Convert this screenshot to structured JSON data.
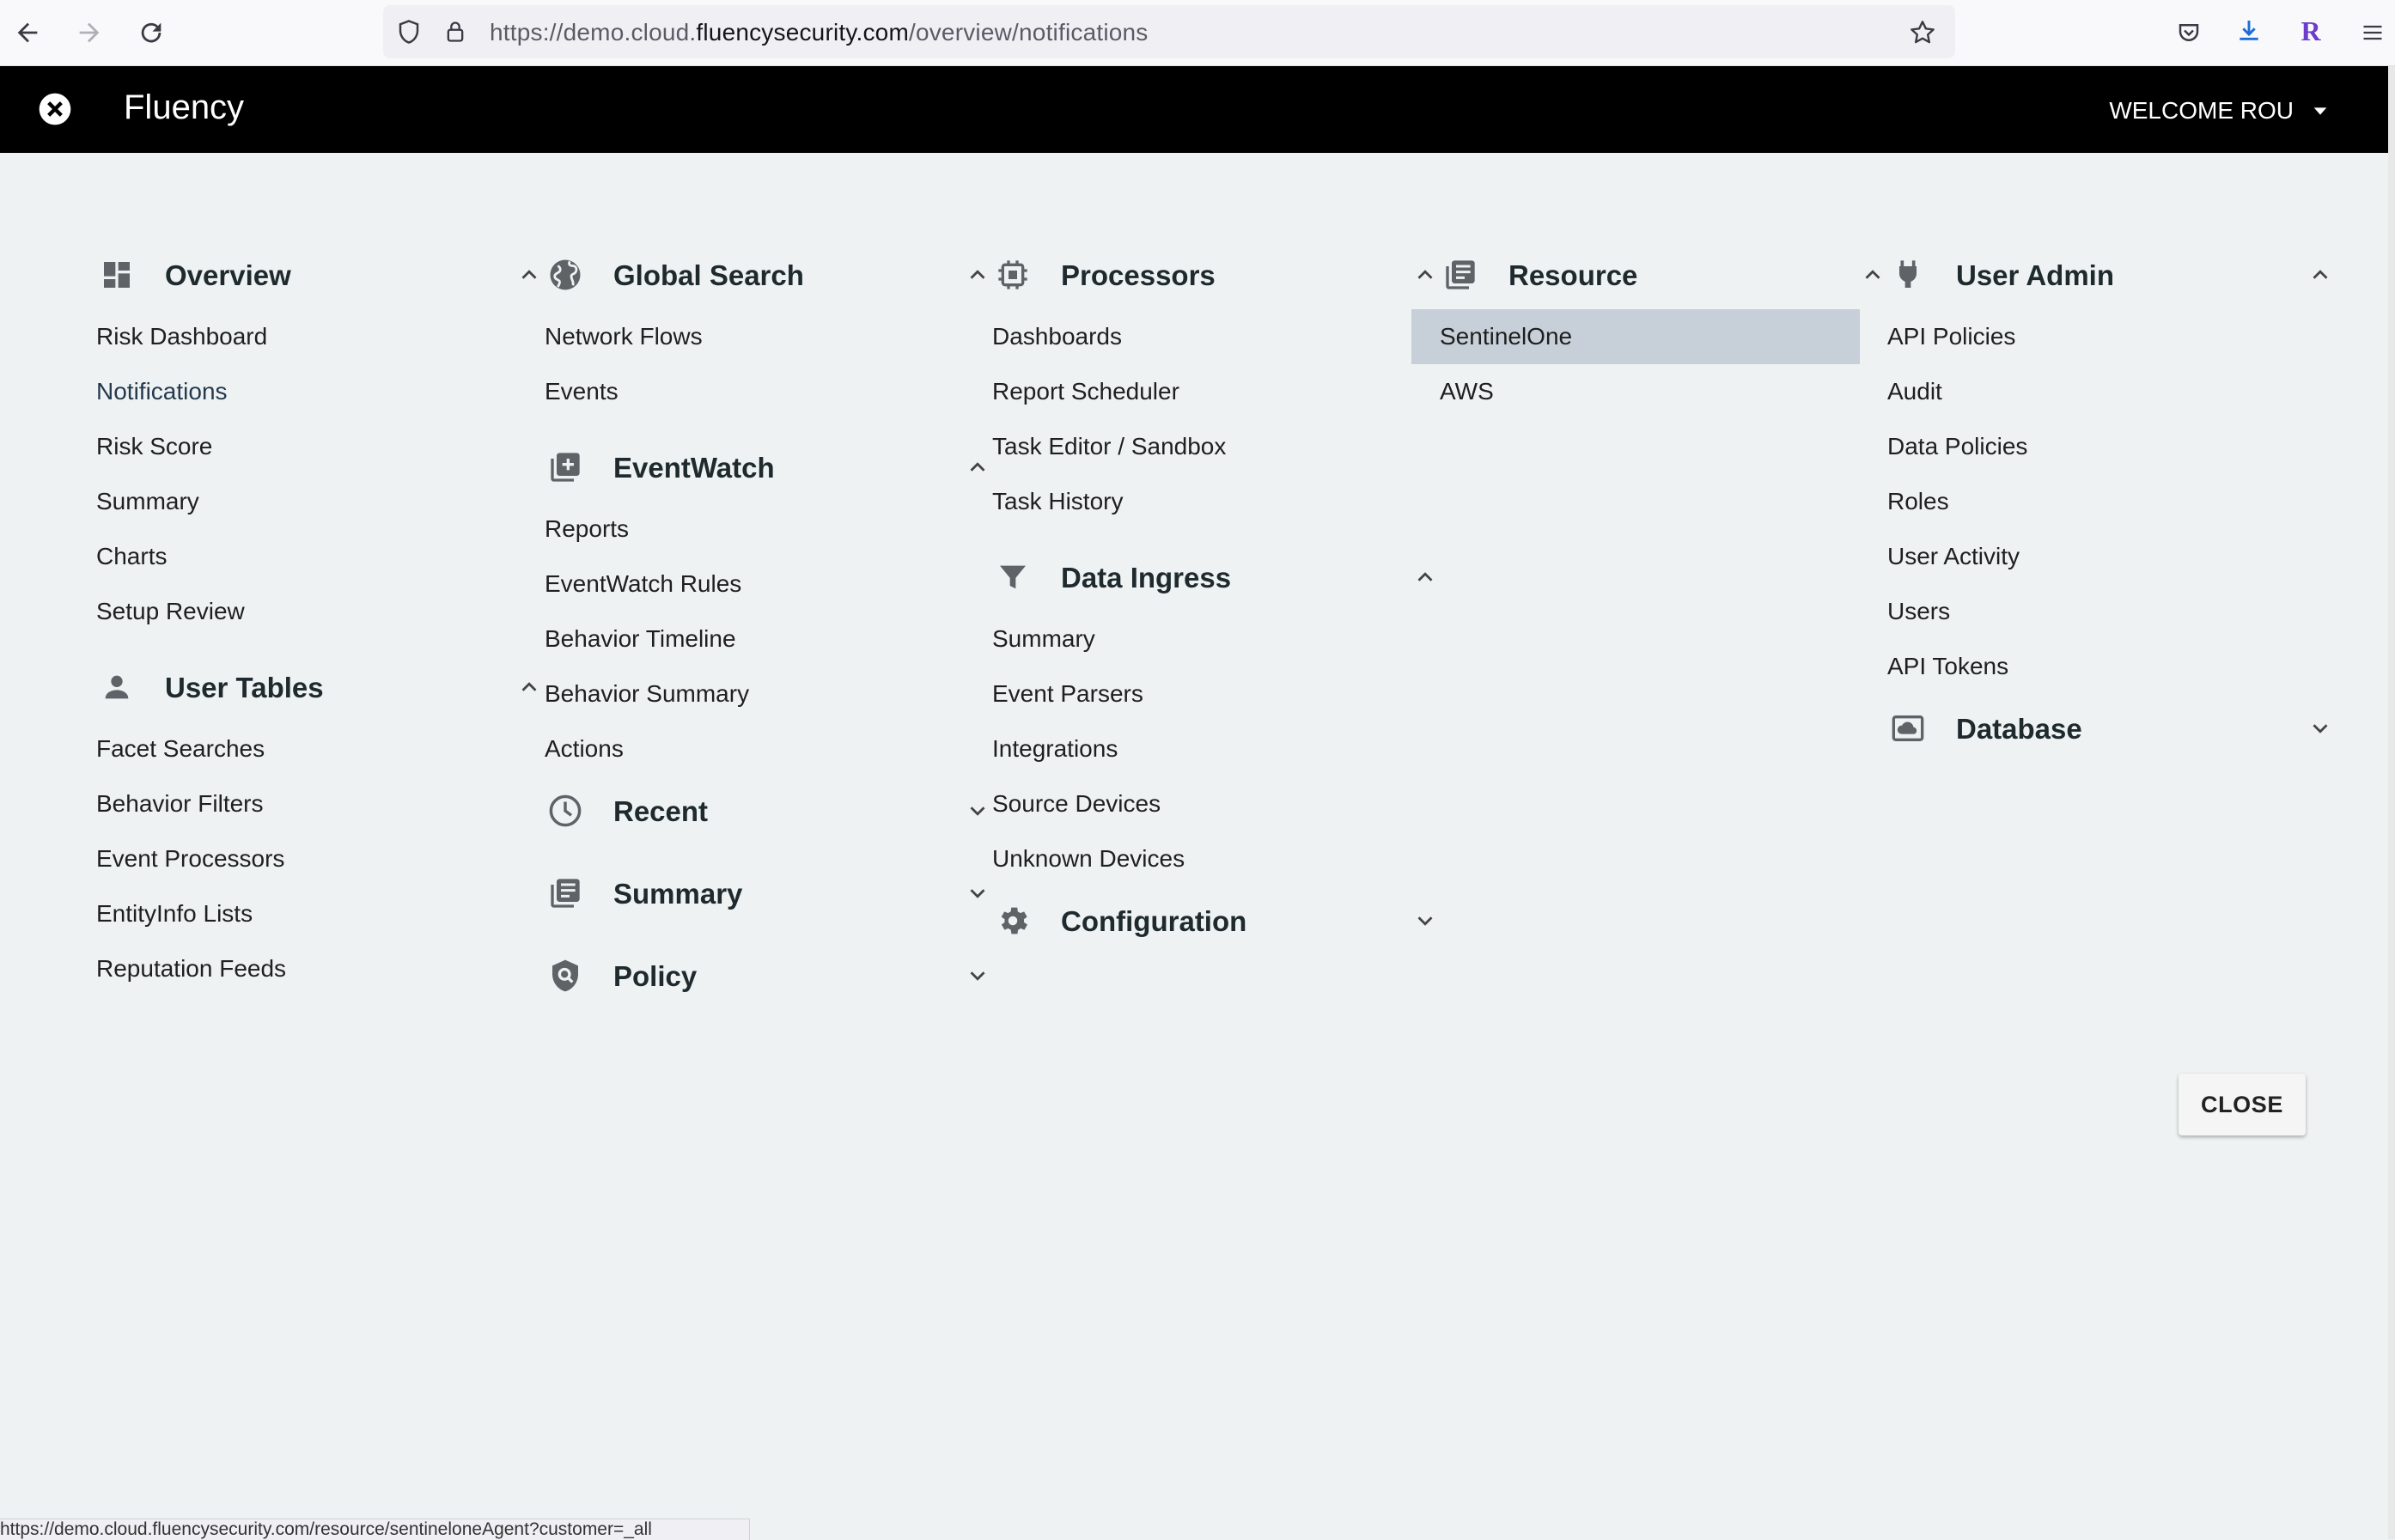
{
  "browser": {
    "url_prefix": "https://demo.cloud.",
    "url_domain": "fluencysecurity.com",
    "url_path": "/overview/notifications",
    "status_url": "https://demo.cloud.fluencysecurity.com/resource/sentineloneAgent?customer=_all",
    "profile_initial": "R"
  },
  "header": {
    "app_title": "Fluency",
    "welcome": "WELCOME ROU"
  },
  "menu": {
    "overview": {
      "title": "Overview",
      "items": [
        "Risk Dashboard",
        "Notifications",
        "Risk Score",
        "Summary",
        "Charts",
        "Setup Review"
      ],
      "active": "Notifications"
    },
    "user_tables": {
      "title": "User Tables",
      "items": [
        "Facet Searches",
        "Behavior Filters",
        "Event Processors",
        "EntityInfo Lists",
        "Reputation Feeds"
      ]
    },
    "global_search": {
      "title": "Global Search",
      "items": [
        "Network Flows",
        "Events"
      ]
    },
    "eventwatch": {
      "title": "EventWatch",
      "items": [
        "Reports",
        "EventWatch Rules",
        "Behavior Timeline",
        "Behavior Summary",
        "Actions"
      ]
    },
    "recent": {
      "title": "Recent"
    },
    "summary": {
      "title": "Summary"
    },
    "policy": {
      "title": "Policy"
    },
    "processors": {
      "title": "Processors",
      "items": [
        "Dashboards",
        "Report Scheduler",
        "Task Editor / Sandbox",
        "Task History"
      ]
    },
    "data_ingress": {
      "title": "Data Ingress",
      "items": [
        "Summary",
        "Event Parsers",
        "Integrations",
        "Source Devices",
        "Unknown Devices"
      ]
    },
    "configuration": {
      "title": "Configuration"
    },
    "resource": {
      "title": "Resource",
      "items": [
        "SentinelOne",
        "AWS"
      ],
      "selected": "SentinelOne"
    },
    "user_admin": {
      "title": "User Admin",
      "items": [
        "API Policies",
        "Audit",
        "Data Policies",
        "Roles",
        "User Activity",
        "Users",
        "API Tokens"
      ]
    },
    "database": {
      "title": "Database"
    }
  },
  "close_label": "CLOSE",
  "colors": {
    "header_bg": "#000000",
    "page_bg": "#eef2f2",
    "selected_bg": "#c7d0d8",
    "icon_gray": "#5f6368"
  }
}
